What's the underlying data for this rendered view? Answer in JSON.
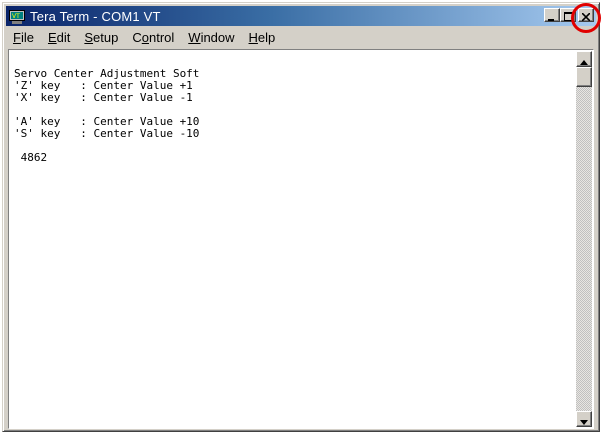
{
  "window": {
    "title": "Tera Term - COM1 VT",
    "app_icon": "tera-term-icon",
    "controls": {
      "minimize_icon": "minimize-icon",
      "maximize_icon": "maximize-icon",
      "close_icon": "close-icon"
    },
    "highlight_color": "#e00000"
  },
  "menu": {
    "items": [
      {
        "label_u": "F",
        "label_rest": "ile"
      },
      {
        "label_u": "E",
        "label_rest": "dit"
      },
      {
        "label_u": "S",
        "label_rest": "etup"
      },
      {
        "label_pre": "C",
        "label_u": "o",
        "label_rest": "ntrol"
      },
      {
        "label_u": "W",
        "label_rest": "indow"
      },
      {
        "label_u": "H",
        "label_rest": "elp"
      }
    ]
  },
  "terminal": {
    "lines": [
      "Servo Center Adjustment Soft",
      "'Z' key   : Center Value +1",
      "'X' key   : Center Value -1",
      "",
      "'A' key   : Center Value +10",
      "'S' key   : Center Value -10",
      "",
      " 4862"
    ]
  },
  "scrollbar": {
    "up_icon": "scroll-up-arrow-icon",
    "down_icon": "scroll-down-arrow-icon"
  },
  "colors": {
    "titlebar_start": "#0a246a",
    "titlebar_end": "#a6caf0",
    "chrome": "#d4d0c8"
  }
}
